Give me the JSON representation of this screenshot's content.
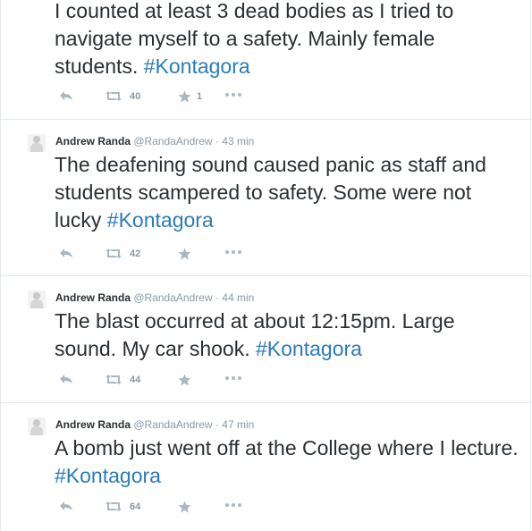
{
  "tweets": [
    {
      "text": "I counted at least 3 dead bodies as I tried to navigate myself to a safety. Mainly female students. ",
      "hashtag": "#Kontagora",
      "retweets": "40",
      "favorites": "1"
    },
    {
      "fullname": "Andrew Randa",
      "username": "@RandaAndrew",
      "separator": "·",
      "time": "43 min",
      "text": "The deafening sound caused panic as staff and students scampered to safety. Some were not lucky ",
      "hashtag": "#Kontagora",
      "retweets": "42",
      "favorites": ""
    },
    {
      "fullname": "Andrew Randa",
      "username": "@RandaAndrew",
      "separator": "·",
      "time": "44 min",
      "text": "The blast occurred at about 12:15pm. Large sound. My car shook. ",
      "hashtag": "#Kontagora",
      "retweets": "44",
      "favorites": ""
    },
    {
      "fullname": "Andrew Randa",
      "username": "@RandaAndrew",
      "separator": "·",
      "time": "47 min",
      "text": "A bomb just went off at the College where I lecture. ",
      "hashtag": "#Kontagora",
      "retweets": "64",
      "favorites": ""
    }
  ],
  "icons": {
    "reply": "reply-icon",
    "retweet": "retweet-icon",
    "favorite": "star-icon",
    "more": "more-dots-icon"
  },
  "colors": {
    "hashtag": "#2b7bb9",
    "text": "#292f33",
    "meta": "#8899a6",
    "icon": "#aab8c2",
    "divider": "#e1e8ed"
  }
}
